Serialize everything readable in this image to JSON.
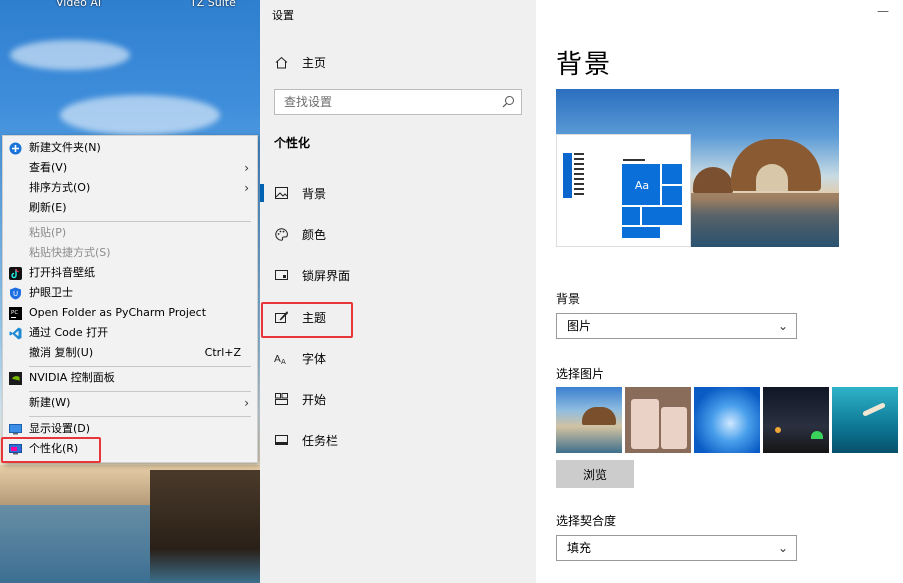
{
  "desktop": {
    "top_labels": [
      "Video AI",
      "TZ Suite"
    ]
  },
  "context_menu": {
    "items": [
      {
        "label": "新建文件夹(N)",
        "icon": "new-folder-icon"
      },
      {
        "label": "查看(V)",
        "submenu": true
      },
      {
        "label": "排序方式(O)",
        "submenu": true
      },
      {
        "label": "刷新(E)"
      },
      {
        "label": "粘贴(P)",
        "disabled": true
      },
      {
        "label": "粘贴快捷方式(S)",
        "disabled": true
      },
      {
        "label": "打开抖音壁纸",
        "icon": "douyin-icon"
      },
      {
        "label": "护眼卫士",
        "icon": "shield-icon"
      },
      {
        "label": "Open Folder as PyCharm Project",
        "icon": "pycharm-icon"
      },
      {
        "label": "通过 Code 打开",
        "icon": "vscode-icon"
      },
      {
        "label": "撤消 复制(U)",
        "shortcut": "Ctrl+Z"
      },
      {
        "label": "NVIDIA 控制面板",
        "icon": "nvidia-icon"
      },
      {
        "label": "新建(W)",
        "submenu": true
      },
      {
        "label": "显示设置(D)",
        "icon": "display-icon"
      },
      {
        "label": "个性化(R)",
        "icon": "personalize-icon"
      }
    ],
    "highlight_color": "#e8353a"
  },
  "settings_nav": {
    "window_title": "设置",
    "home_label": "主页",
    "search_placeholder": "查找设置",
    "section_label": "个性化",
    "items": [
      {
        "label": "背景",
        "icon": "picture-icon",
        "active": true
      },
      {
        "label": "颜色",
        "icon": "palette-icon"
      },
      {
        "label": "锁屏界面",
        "icon": "lock-screen-icon"
      },
      {
        "label": "主题",
        "icon": "theme-brush-icon",
        "highlighted": true
      },
      {
        "label": "字体",
        "icon": "font-icon"
      },
      {
        "label": "开始",
        "icon": "start-icon"
      },
      {
        "label": "任务栏",
        "icon": "taskbar-icon"
      }
    ],
    "accent_color": "#0063b1"
  },
  "main": {
    "title": "背景",
    "preview_text": "Aa",
    "background_label": "背景",
    "background_value": "图片",
    "choose_picture_label": "选择图片",
    "browse_label": "浏览",
    "fit_label": "选择契合度",
    "fit_value": "填充",
    "thumbnails": [
      "beach-arch-thumbnail",
      "app-window-thumbnail",
      "windows-logo-thumbnail",
      "night-sky-thumbnail",
      "underwater-thumbnail"
    ]
  }
}
